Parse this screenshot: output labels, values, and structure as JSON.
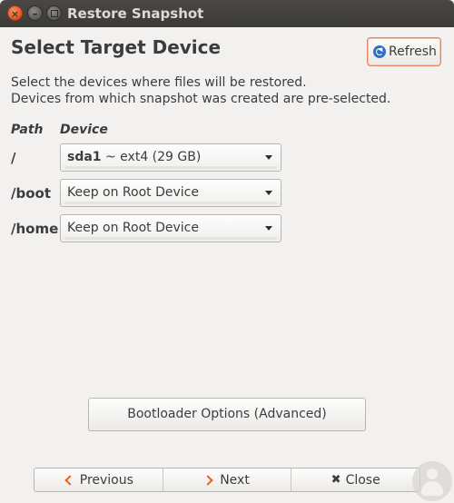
{
  "window": {
    "title": "Restore Snapshot",
    "controls": {
      "close_glyph": "×",
      "minimize_glyph": "–"
    }
  },
  "header": {
    "title": "Select Target Device",
    "refresh_label": "Refresh"
  },
  "description": {
    "line1": "Select the devices where files will be restored.",
    "line2": "Devices from which snapshot was created are pre-selected."
  },
  "table": {
    "path_header": "Path",
    "device_header": "Device",
    "rows": [
      {
        "path": "/",
        "device_bold": "sda1",
        "device_rest": " ~ ext4 (29 GB)"
      },
      {
        "path": "/boot",
        "device_bold": "",
        "device_rest": "Keep on Root Device"
      },
      {
        "path": "/home",
        "device_bold": "",
        "device_rest": "Keep on Root Device"
      }
    ]
  },
  "bootloader_label": "Bootloader Options (Advanced)",
  "nav": {
    "previous_label": "Previous",
    "next_label": "Next",
    "close_label": "Close",
    "close_glyph": "✖"
  },
  "colors": {
    "accent": "#e2611e",
    "titlebar": "#3b3a36",
    "background": "#f2f1f0"
  }
}
